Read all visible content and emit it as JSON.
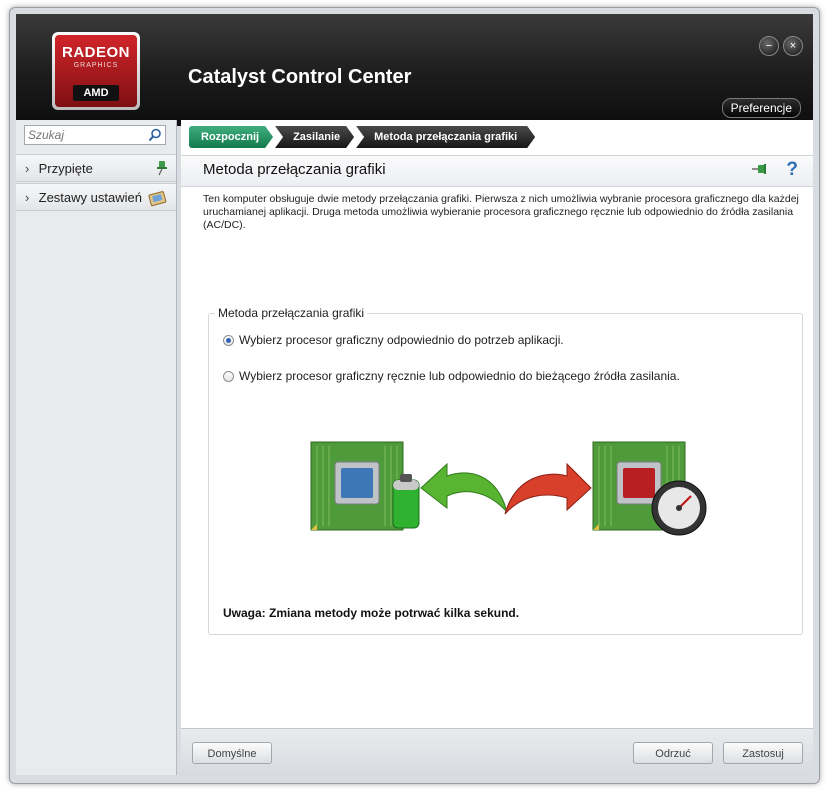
{
  "header": {
    "logo": {
      "line1": "RADEON",
      "line2": "GRAPHICS",
      "brand": "AMD"
    },
    "title": "Catalyst Control Center",
    "minimize_icon": "minimize-icon",
    "close_icon": "close-icon",
    "preferences_label": "Preferencje"
  },
  "sidebar": {
    "search_placeholder": "Szukaj",
    "items": [
      {
        "label": "Przypięte",
        "icon": "pin-icon"
      },
      {
        "label": "Zestawy ustawień",
        "icon": "presets-icon"
      }
    ]
  },
  "breadcrumb": {
    "items": [
      "Rozpocznij",
      "Zasilanie",
      "Metoda przełączania grafiki"
    ]
  },
  "page": {
    "title": "Metoda przełączania grafiki",
    "description": "Ten komputer obsługuje dwie metody przełączania grafiki. Pierwsza z nich umożliwia wybranie procesora graficznego dla każdej uruchamianej aplikacji. Druga metoda umożliwia wybieranie procesora graficznego ręcznie lub odpowiednio do źródła zasilania (AC/DC).",
    "group_title": "Metoda przełączania grafiki",
    "options": [
      {
        "label": "Wybierz procesor graficzny odpowiednio do potrzeb aplikacji.",
        "selected": true
      },
      {
        "label": "Wybierz procesor graficzny ręcznie lub odpowiednio do bieżącego źródła zasilania.",
        "selected": false
      }
    ],
    "warning": "Uwaga: Zmiana metody może potrwać kilka sekund."
  },
  "footer": {
    "defaults_label": "Domyślne",
    "discard_label": "Odrzuć",
    "apply_label": "Zastosuj"
  },
  "colors": {
    "accent_green": "#1f8a5a",
    "header_dark": "#1c1c1c",
    "radio_selected": "#2d64b0"
  }
}
